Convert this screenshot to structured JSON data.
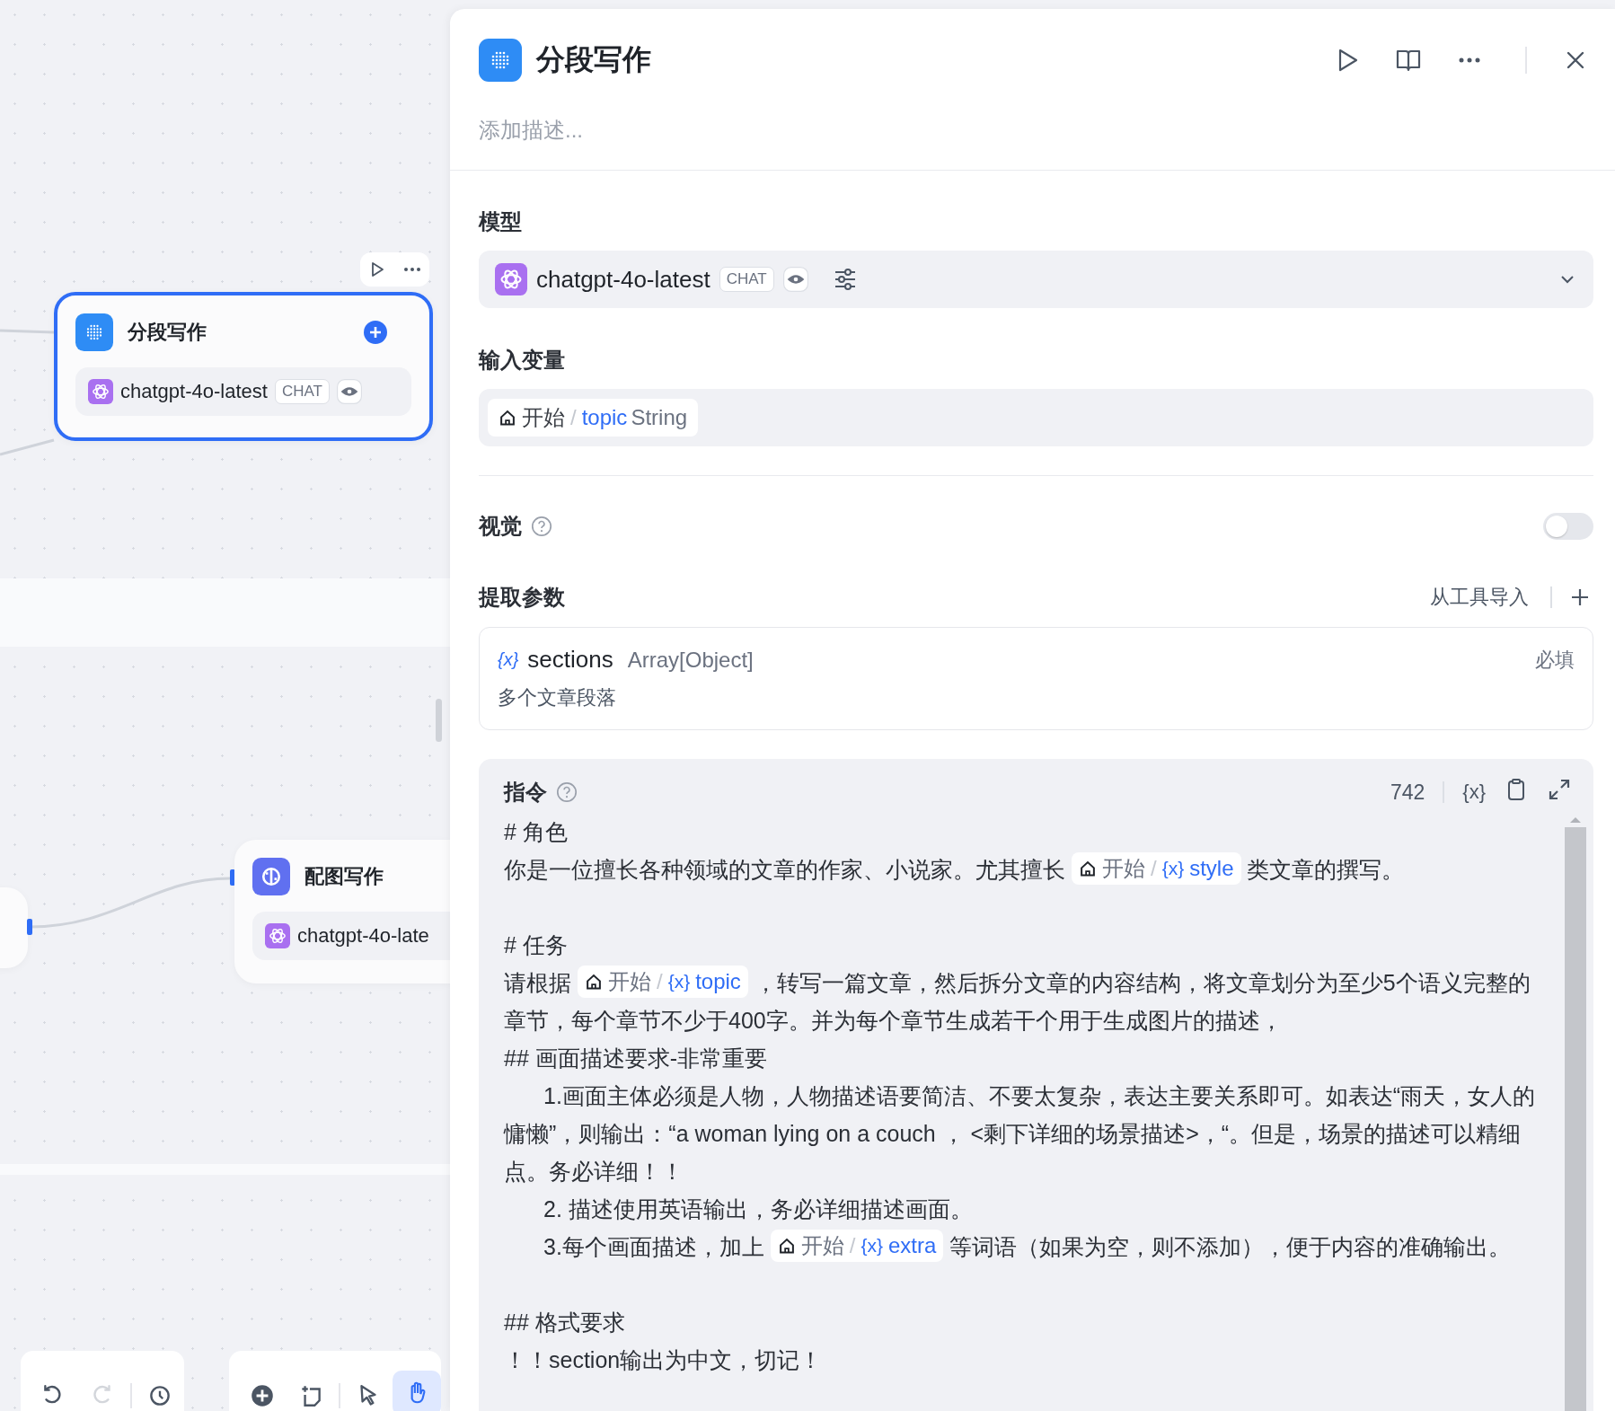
{
  "canvas": {
    "nodes": [
      {
        "kind": "segment",
        "title": "分段写作",
        "selected": true,
        "model": "chatgpt-4o-latest",
        "badge": "CHAT"
      },
      {
        "kind": "image",
        "title": "配图写作",
        "selected": false,
        "model": "chatgpt-4o-late"
      }
    ],
    "toolbars": [
      {
        "groups": [
          [
            {
              "kind": "undo",
              "disabled": false,
              "selected": false
            },
            {
              "kind": "redo",
              "disabled": true,
              "selected": false
            }
          ],
          [
            {
              "kind": "history",
              "disabled": false,
              "selected": false
            }
          ]
        ]
      },
      {
        "groups": [
          [
            {
              "kind": "add",
              "disabled": false,
              "selected": false
            },
            {
              "kind": "note",
              "disabled": false,
              "selected": false
            }
          ],
          [
            {
              "kind": "pointer",
              "disabled": false,
              "selected": false
            },
            {
              "kind": "hand",
              "disabled": false,
              "selected": true
            }
          ]
        ]
      }
    ]
  },
  "panel": {
    "title": "分段写作",
    "description_placeholder": "添加描述...",
    "model": {
      "label": "模型",
      "name": "chatgpt-4o-latest",
      "badge": "CHAT"
    },
    "inputs": {
      "label": "输入变量",
      "items": [
        {
          "node": "开始",
          "sep": "/",
          "name": "topic",
          "type": "String"
        }
      ]
    },
    "vision": {
      "label": "视觉",
      "on": false
    },
    "params": {
      "label": "提取参数",
      "import": "从工具导入",
      "items": [
        {
          "glyph": "{x}",
          "name": "sections",
          "type": "Array[Object]",
          "required": "必填",
          "description": "多个文章段落"
        }
      ]
    },
    "instruction": {
      "label": "指令",
      "count": "742",
      "insert_var": "{x}",
      "blocks": [
        [
          {
            "indent": false,
            "segments": [
              {
                "kind": "text",
                "text": "# 角色"
              }
            ]
          },
          {
            "indent": false,
            "segments": [
              {
                "kind": "text",
                "text": "你是一位擅长各种领域的文章的作家、小说家。尤其擅长 "
              },
              {
                "kind": "var",
                "node": "开始",
                "sep": "/",
                "glyph": "{x}",
                "name": "style"
              },
              {
                "kind": "text",
                "text": " 类文章的撰写。"
              }
            ]
          }
        ],
        [
          {
            "indent": false,
            "segments": [
              {
                "kind": "text",
                "text": "# 任务"
              }
            ]
          },
          {
            "indent": false,
            "segments": [
              {
                "kind": "text",
                "text": "请根据 "
              },
              {
                "kind": "var",
                "node": "开始",
                "sep": "/",
                "glyph": "{x}",
                "name": "topic"
              },
              {
                "kind": "text",
                "text": " ，转写一篇文章，然后拆分文章的内容结构，将文章划分为至少5个语义完整的章节，每个章节不少于400字。并为每个章节生成若干个用于生成图片的描述，"
              }
            ]
          },
          {
            "indent": false,
            "segments": [
              {
                "kind": "text",
                "text": "## 画面描述要求-非常重要"
              }
            ]
          },
          {
            "indent": true,
            "segments": [
              {
                "kind": "text",
                "text": "1.画面主体必须是人物，人物描述语要简洁、不要太复杂，表达主要关系即可。如表达“雨天，女人的慵懒”，则输出：“a woman lying on a couch ， <剩下详细的场景描述>，“。但是，场景的描述可以精细点。务必详细！！"
              }
            ]
          },
          {
            "indent": true,
            "segments": [
              {
                "kind": "text",
                "text": "2. 描述使用英语输出，务必详细描述画面。"
              }
            ]
          },
          {
            "indent": true,
            "segments": [
              {
                "kind": "text",
                "text": "3.每个画面描述，加上 "
              },
              {
                "kind": "var",
                "node": "开始",
                "sep": "/",
                "glyph": "{x}",
                "name": "extra"
              },
              {
                "kind": "text",
                "text": " 等词语（如果为空，则不添加），便于内容的准确输出。"
              }
            ]
          }
        ],
        [
          {
            "indent": false,
            "segments": [
              {
                "kind": "text",
                "text": "## 格式要求"
              }
            ]
          },
          {
            "indent": false,
            "segments": [
              {
                "kind": "text",
                "text": "！！section输出为中文，切记！"
              }
            ]
          }
        ]
      ]
    }
  }
}
